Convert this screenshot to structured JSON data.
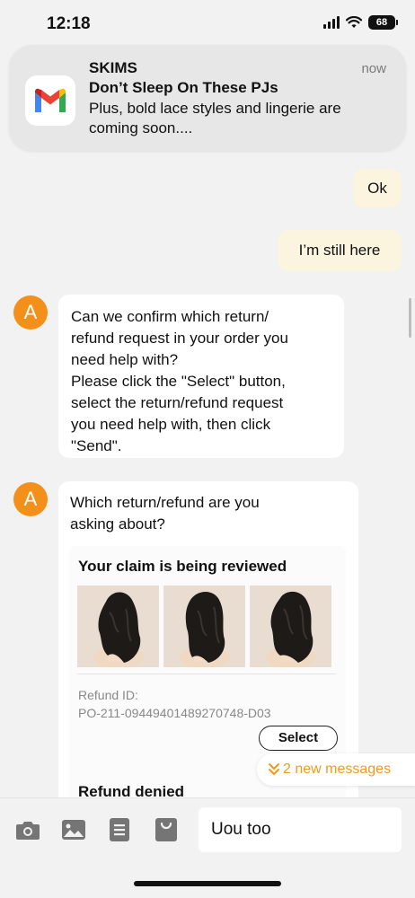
{
  "status_bar": {
    "time": "12:18",
    "battery": "68"
  },
  "notification": {
    "app": "SKIMS",
    "time": "now",
    "title": "Don’t Sleep On These PJs",
    "body": "Plus, bold lace styles and lingerie are coming soon....",
    "icon": "gmail-icon"
  },
  "chat": {
    "outgoing": [
      {
        "text": "Ok"
      },
      {
        "text": "I’m still here"
      }
    ],
    "agent_avatar": "A",
    "incoming": [
      {
        "text_lines": [
          "Can we confirm which return/",
          "refund request in your order you",
          "need help with?",
          "Please click the \"Select\" button,",
          "select the return/refund request",
          "you need help with, then click",
          "\"Send\"."
        ]
      },
      {
        "text_lines": [
          "Which return/refund are you",
          "asking about?"
        ]
      }
    ],
    "claim_card": {
      "title": "Your claim is being reviewed",
      "refund_id_label": "Refund ID:",
      "refund_id": "PO-211-09449401489270748-D03",
      "select_label": "Select"
    },
    "denied_card": {
      "title": "Refund denied"
    },
    "new_messages": "2 new messages"
  },
  "toolbar": {
    "icons": [
      "camera-icon",
      "image-icon",
      "order-list-icon",
      "shopping-bag-icon"
    ],
    "input_value": "Uou too"
  },
  "colors": {
    "accent": "#f39019",
    "outgoing_bubble": "#fbf4df",
    "background": "#f2f2f2"
  }
}
